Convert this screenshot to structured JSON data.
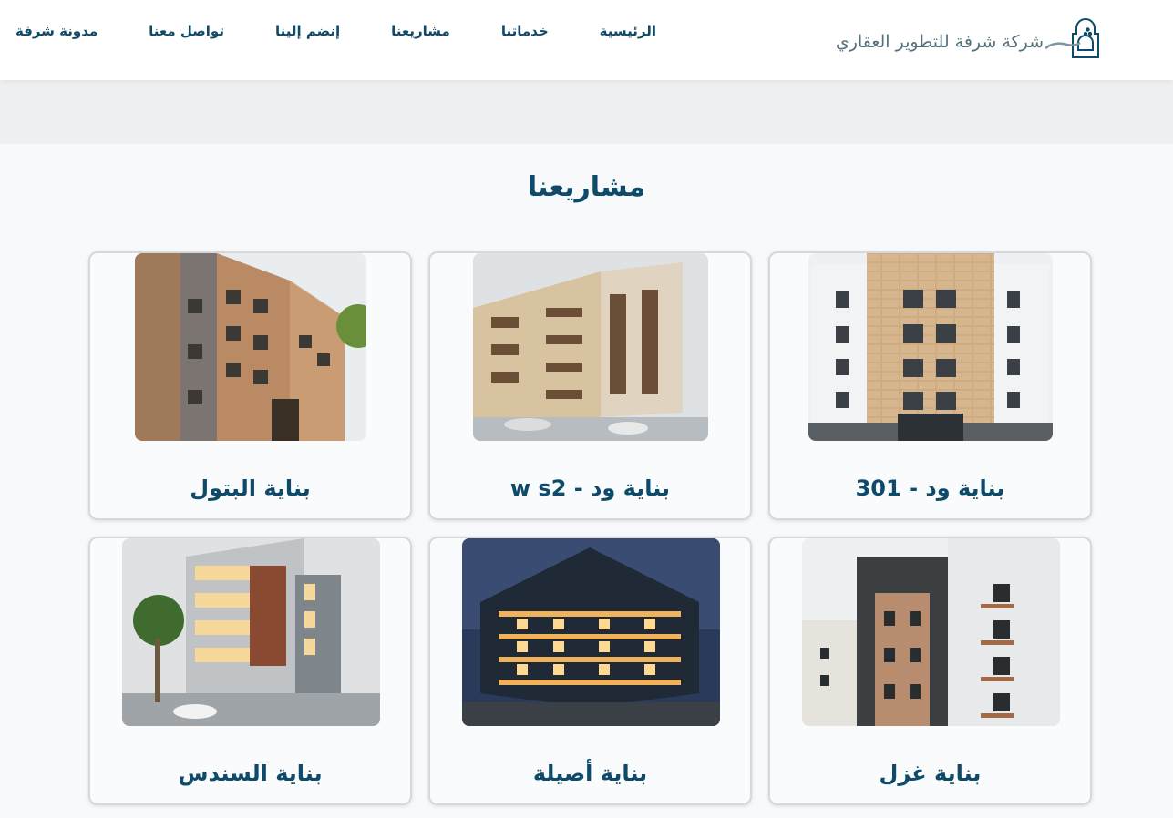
{
  "brand": {
    "name": "شركة شرفة للتطوير العقاري",
    "logo_icon": "shorfa-logo-icon"
  },
  "nav": {
    "items": [
      {
        "label": "الرئيسية"
      },
      {
        "label": "خدماتنا"
      },
      {
        "label": "مشاريعنا"
      },
      {
        "label": "إنضم إلينا"
      },
      {
        "label": "تواصل معنا"
      },
      {
        "label": "مدونة شرفة"
      }
    ]
  },
  "section": {
    "title": "مشاريعنا"
  },
  "projects": [
    {
      "title": "بناية ود - 301"
    },
    {
      "title": "بناية ود - w s2"
    },
    {
      "title": "بناية البتول"
    },
    {
      "title": "بناية غزل"
    },
    {
      "title": "بناية أصيلة"
    },
    {
      "title": "بناية السندس"
    }
  ],
  "colors": {
    "primary": "#0e4b6a",
    "background": "#f8f9fb",
    "card_border": "#d6d8db"
  }
}
